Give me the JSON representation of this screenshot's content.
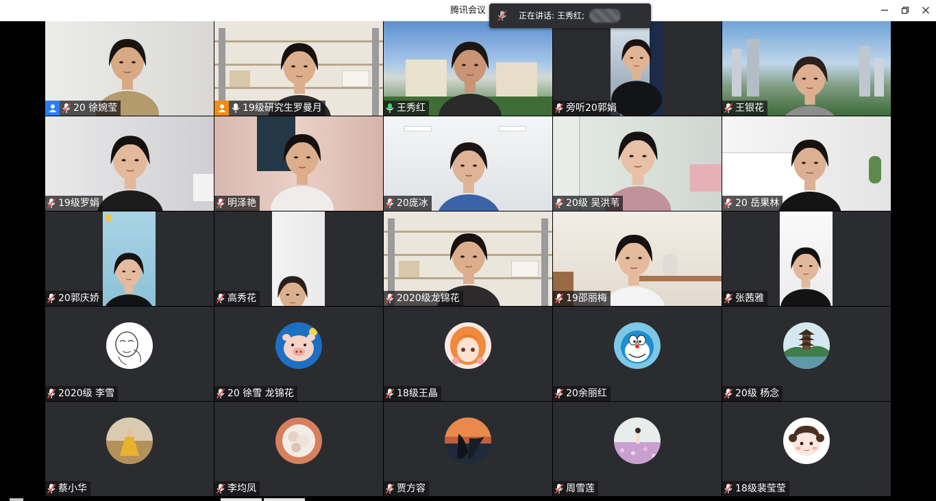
{
  "window": {
    "title": "腾讯会议"
  },
  "speaking_banner": {
    "label": "正在讲话: 王秀红;"
  },
  "participants": [
    {
      "name": "20 徐婉莹",
      "host": "blue",
      "mic": "muted",
      "view": "video",
      "scene": "wall-light"
    },
    {
      "name": "19级研究生罗曼月",
      "host": "orange",
      "mic": "on-white",
      "view": "video",
      "scene": "shelf"
    },
    {
      "name": "王秀红",
      "mic": "speaking",
      "view": "video",
      "scene": "campus",
      "active": true
    },
    {
      "name": "旁听20郭娟",
      "mic": "muted",
      "view": "portrait",
      "scene": "city-dark"
    },
    {
      "name": "王银花",
      "mic": "muted",
      "view": "video",
      "scene": "city"
    },
    {
      "name": "19级罗娟",
      "mic": "muted",
      "view": "video",
      "scene": "room-white"
    },
    {
      "name": "明泽艳",
      "mic": "muted",
      "view": "video",
      "scene": "curtain"
    },
    {
      "name": "20庞冰",
      "mic": "muted",
      "view": "video",
      "scene": "ceiling"
    },
    {
      "name": "20级 吴洪苇",
      "mic": "muted",
      "view": "video",
      "scene": "bedroom"
    },
    {
      "name": "20 岳果林",
      "mic": "muted",
      "view": "video",
      "scene": "white-hall"
    },
    {
      "name": "20郭庆娇",
      "mic": "muted",
      "view": "portrait",
      "scene": "blue-wall"
    },
    {
      "name": "高秀花",
      "mic": "muted",
      "view": "portrait",
      "scene": "white-door"
    },
    {
      "name": "2020级龙锦花",
      "mic": "muted",
      "view": "video",
      "scene": "shelf"
    },
    {
      "name": "19邵丽梅",
      "mic": "muted",
      "view": "video",
      "scene": "dining"
    },
    {
      "name": "张茜雅",
      "mic": "muted",
      "view": "portrait",
      "scene": "white-wall"
    },
    {
      "name": "2020级 李雪",
      "mic": "muted",
      "view": "avatar",
      "avatar": "sketch-face"
    },
    {
      "name": "20 徐雪 龙锦花",
      "mic": "muted",
      "view": "avatar",
      "avatar": "pig"
    },
    {
      "name": "18级王晶",
      "mic": "muted",
      "view": "avatar",
      "avatar": "anime-girl"
    },
    {
      "name": "20余丽红",
      "mic": "muted",
      "view": "avatar",
      "avatar": "doraemon"
    },
    {
      "name": "20级 杨念",
      "mic": "muted",
      "view": "avatar",
      "avatar": "pagoda"
    },
    {
      "name": "蔡小华",
      "mic": "muted",
      "view": "avatar",
      "avatar": "field-girl"
    },
    {
      "name": "李均凤",
      "mic": "muted",
      "view": "avatar",
      "avatar": "flowers"
    },
    {
      "name": "贾方容",
      "mic": "muted",
      "view": "avatar",
      "avatar": "sunset-couple"
    },
    {
      "name": "周雪莲",
      "mic": "muted",
      "view": "avatar",
      "avatar": "flower-field"
    },
    {
      "name": "18级裴莹莹",
      "mic": "muted",
      "view": "avatar",
      "avatar": "cartoon-girl"
    }
  ],
  "colors": {
    "tile_bg": "#2b2c30",
    "active_border": "#2fb15e",
    "muted_red": "#e64545",
    "host_blue": "#2d7cf6",
    "host_orange": "#f28b17"
  }
}
